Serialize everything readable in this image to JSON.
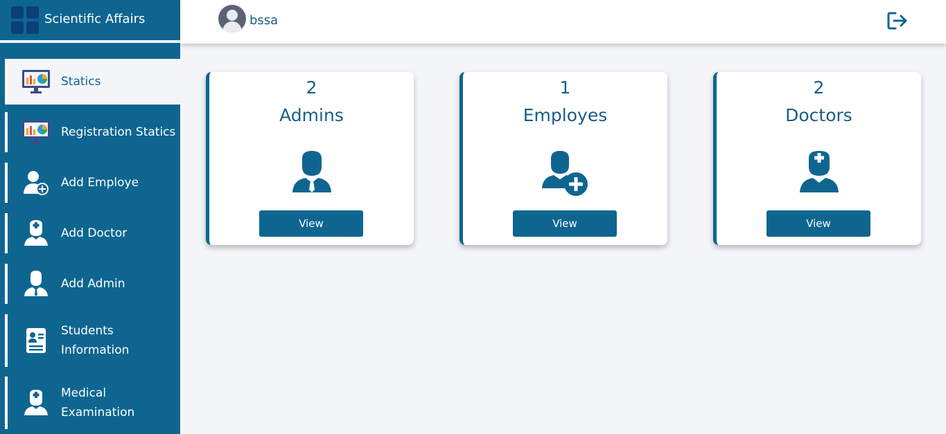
{
  "brand": {
    "title": "Scientific Affairs"
  },
  "user": {
    "name": "bssa"
  },
  "sidebar": {
    "items": [
      {
        "label": "Statics",
        "icon": "statistics-monitor-icon",
        "active": true
      },
      {
        "label": "Registration Statics",
        "icon": "statistics-monitor-icon"
      },
      {
        "label": "Add Employe",
        "icon": "user-add-icon"
      },
      {
        "label": "Add Doctor",
        "icon": "doctor-icon"
      },
      {
        "label": "Add Admin",
        "icon": "admin-icon"
      },
      {
        "label": "Students Information",
        "icon": "id-card-icon"
      },
      {
        "label": "Medical Examination",
        "icon": "doctor-icon"
      }
    ]
  },
  "cards": [
    {
      "count": "2",
      "title": "Admins",
      "button": "View",
      "icon": "admin-icon"
    },
    {
      "count": "1",
      "title": "Employes",
      "button": "View",
      "icon": "user-add-icon"
    },
    {
      "count": "2",
      "title": "Doctors",
      "button": "View",
      "icon": "doctor-icon"
    }
  ],
  "colors": {
    "primary": "#0e6690",
    "background": "#f4f5f9",
    "text": "#1a5d86"
  }
}
